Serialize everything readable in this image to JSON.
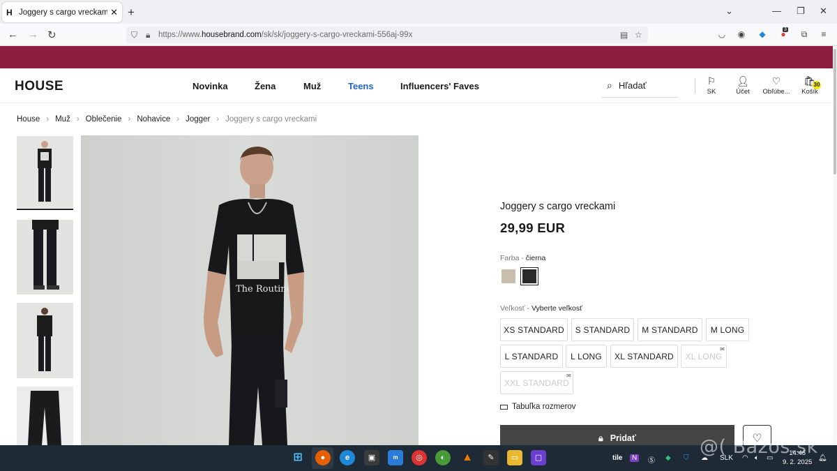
{
  "browser": {
    "tab_title": "Joggery s cargo vreckami Farba",
    "tab_favicon": "H",
    "url_prefix": "https://www.",
    "url_host": "housebrand.com",
    "url_path": "/sk/sk/joggery-s-cargo-vreckami-556aj-99x",
    "extension_badge": "3"
  },
  "header": {
    "logo": "HOUSE",
    "nav": [
      "Novinka",
      "Žena",
      "Muž",
      "Teens",
      "Influencers' Faves"
    ],
    "search_placeholder": "Hľadať",
    "icons": {
      "region": "SK",
      "account": "Účet",
      "favorites": "Obľúbe...",
      "cart": "Košík",
      "cart_count": "30"
    }
  },
  "breadcrumb": [
    "House",
    "Muž",
    "Oblečenie",
    "Nohavice",
    "Jogger",
    "Joggery s cargo vreckami"
  ],
  "product": {
    "title": "Joggery s cargo vreckami",
    "price": "29,99 EUR",
    "color_label": "Farba -",
    "color_value": "čierna",
    "swatches": [
      "#c9bfad",
      "#2a2a2a"
    ],
    "size_label": "Veľkosť -",
    "size_value": "Vyberte veľkosť",
    "sizes": [
      {
        "label": "XS STANDARD",
        "available": true
      },
      {
        "label": "S STANDARD",
        "available": true
      },
      {
        "label": "M STANDARD",
        "available": true
      },
      {
        "label": "M LONG",
        "available": true
      },
      {
        "label": "L STANDARD",
        "available": true
      },
      {
        "label": "L LONG",
        "available": true
      },
      {
        "label": "XL STANDARD",
        "available": true
      },
      {
        "label": "XL LONG",
        "available": false
      },
      {
        "label": "XXL STANDARD",
        "available": false
      }
    ],
    "size_table": "Tabuľka rozmerov",
    "add_button": "Pridať"
  },
  "watermark": "@( Bazos.sk",
  "taskbar": {
    "tray_weather": "tile",
    "language": "SLK",
    "time": "14:46",
    "date": "9. 2. 2025"
  },
  "colors": {
    "promo_bar": "#8b1d3f",
    "teens_link": "#1f66d1",
    "cart_badge": "#f3e600",
    "add_button": "#444444",
    "taskbar": "#1e2a36"
  }
}
